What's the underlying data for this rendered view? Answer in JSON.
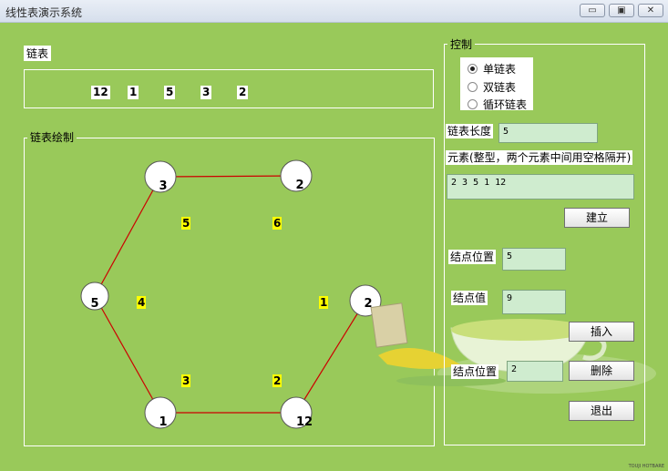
{
  "window": {
    "title": "线性表演示系统",
    "minimize_glyph": "▭",
    "maximize_glyph": "▣",
    "close_glyph": "✕"
  },
  "list_group": {
    "label": "链表",
    "values": [
      "12",
      "1",
      "5",
      "3",
      "2"
    ]
  },
  "draw_group": {
    "label": "链表绘制",
    "nodes": [
      "3",
      "2",
      "5",
      "2",
      "1",
      "12"
    ],
    "edge_labels": [
      "5",
      "6",
      "4",
      "1",
      "3",
      "2"
    ]
  },
  "control": {
    "label": "控制",
    "radios": [
      {
        "label": "单链表",
        "checked": true
      },
      {
        "label": "双链表",
        "checked": false
      },
      {
        "label": "循环链表",
        "checked": false
      }
    ],
    "length_label": "链表长度",
    "length_value": "5",
    "elements_label": "元素(整型，两个元素中间用空格隔开)",
    "elements_value": "2 3 5 1 12",
    "build_button": "建立",
    "insert_pos_label": "结点位置",
    "insert_pos_value": "5",
    "node_value_label": "结点值",
    "node_value_value": "9",
    "insert_button": "插入",
    "delete_pos_label": "结点位置",
    "delete_pos_value": "2",
    "delete_button": "删除",
    "exit_button": "退出"
  },
  "footer": {
    "text": "TOUJI HOTBARE"
  },
  "colors": {
    "background": "#99c95a",
    "edge": "#cc0000",
    "label_highlight": "#ffff00",
    "field": "#cfeccf"
  }
}
